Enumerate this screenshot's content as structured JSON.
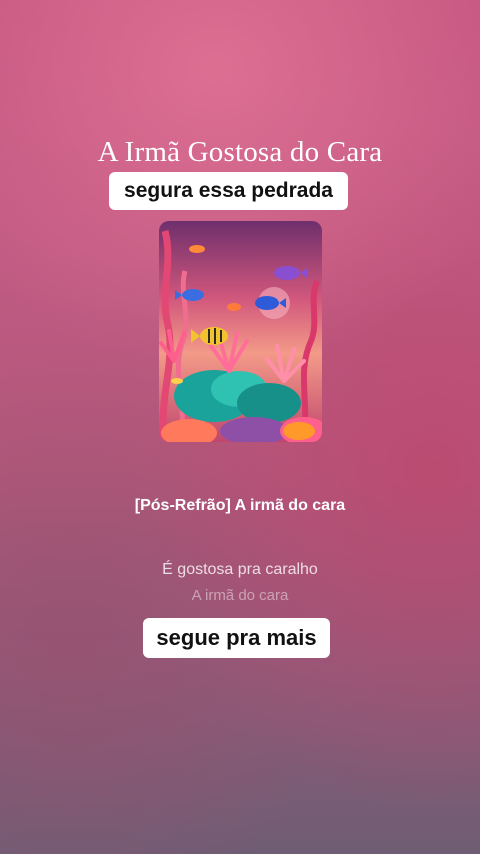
{
  "song": {
    "title": "A Irmã Gostosa do Cara"
  },
  "stickers": {
    "top": "segura essa pedrada",
    "bottom": "segue pra mais"
  },
  "lyrics": {
    "active": "[Pós-Refrão] A irmã do cara",
    "next": "É gostosa pra caralho",
    "after": "A irmã do cara"
  },
  "cover": {
    "icon": "underwater-coral-reef-artwork"
  }
}
